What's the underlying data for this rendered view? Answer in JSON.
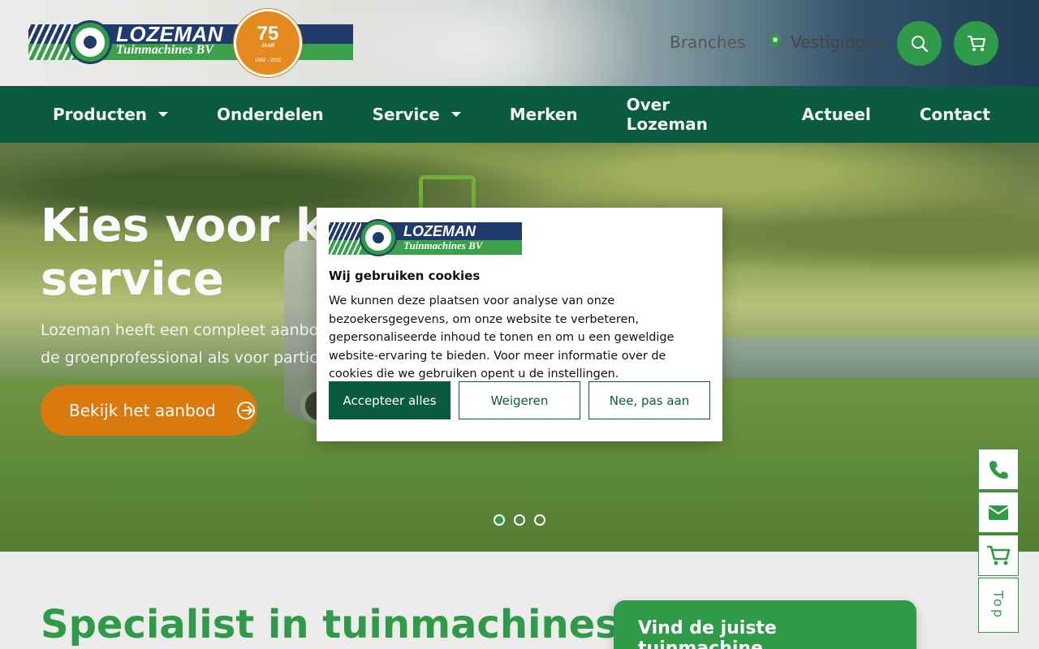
{
  "header": {
    "logo": {
      "brand": "LOZEMAN",
      "subtitle": "Tuinmachines BV",
      "anniversary_number": "75",
      "anniversary_word": "JAAR",
      "anniversary_years": "1950 - 2025"
    },
    "links": {
      "branches": "Branches",
      "locations": "Vestigingen"
    },
    "icons": {
      "search": "search-icon",
      "cart": "cart-icon",
      "location": "map-pin-icon"
    }
  },
  "nav": {
    "items": [
      {
        "label": "Producten",
        "dropdown": true
      },
      {
        "label": "Onderdelen",
        "dropdown": false
      },
      {
        "label": "Service",
        "dropdown": true
      },
      {
        "label": "Merken",
        "dropdown": false
      },
      {
        "label": "Over Lozeman",
        "dropdown": false
      },
      {
        "label": "Actueel",
        "dropdown": false
      },
      {
        "label": "Contact",
        "dropdown": false
      }
    ]
  },
  "hero": {
    "title_line1": "Kies voor kwa",
    "title_line2": "service",
    "text_line1": "Lozeman heeft een compleet aanbod t",
    "text_line2": "de groenprofessional als voor particulie",
    "cta_label": "Bekijk het aanbod",
    "slides": 3,
    "active_slide": 1
  },
  "section": {
    "heading": "Specialist in tuinmachines",
    "finder_title": "Vind de juiste tuinmachine"
  },
  "side_bar": {
    "icons": [
      "phone-icon",
      "email-icon",
      "cart-icon"
    ],
    "top_label": "Top"
  },
  "cookie_modal": {
    "logo_brand": "LOZEMAN",
    "logo_subtitle": "Tuinmachines BV",
    "title": "Wij gebruiken cookies",
    "body": "We kunnen deze plaatsen voor analyse van onze bezoekersgegevens, om onze website te verbeteren, gepersonaliseerde inhoud te tonen en om u een geweldige website-ervaring te bieden. Voor meer informatie over de cookies die we gebruiken opent u de instellingen.",
    "accept_label": "Accepteer alles",
    "decline_label": "Weigeren",
    "customize_label": "Nee, pas aan"
  },
  "colors": {
    "primary_green": "#2f9a47",
    "dark_green": "#0b5a42",
    "navy": "#203a6b",
    "orange": "#d9790e"
  }
}
